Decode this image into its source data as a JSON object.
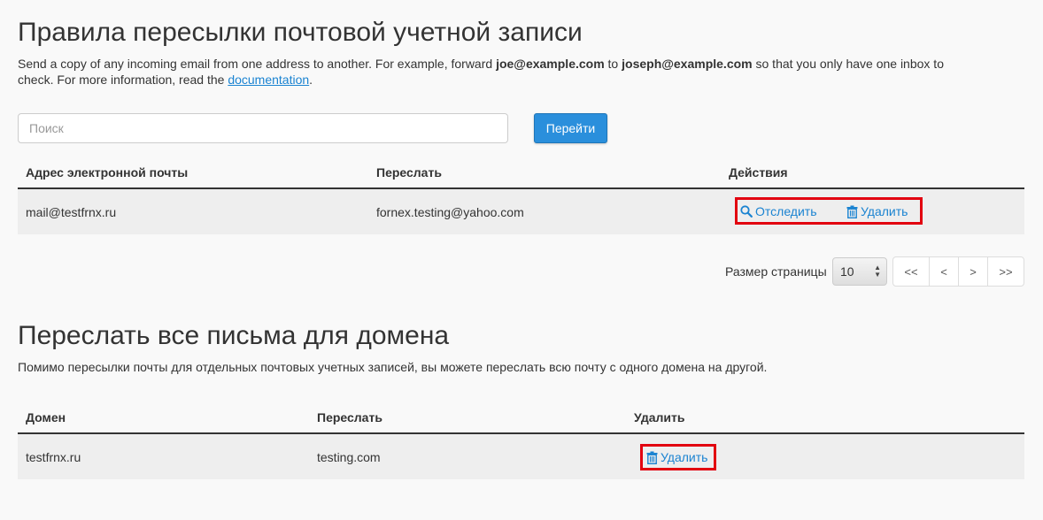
{
  "forwarders": {
    "title": "Правила пересылки почтовой учетной записи",
    "description": {
      "part1": "Send a copy of any incoming email from one address to another. For example, forward ",
      "bold1": "joe@example.com",
      "part2": " to ",
      "bold2": "joseph@example.com",
      "part3": " so that you only have one inbox to",
      "line2_prefix": "check. For more information, read the ",
      "link": "documentation",
      "line2_suffix": "."
    },
    "search": {
      "placeholder": "Поиск",
      "button": "Перейти"
    },
    "columns": [
      "Адрес электронной почты",
      "Переслать",
      "Действия"
    ],
    "rows": [
      {
        "email": "mail@testfrnx.ru",
        "forward": "fornex.testing@yahoo.com",
        "trace": "Отследить",
        "delete": "Удалить"
      }
    ],
    "pagination": {
      "page_size_label": "Размер страницы",
      "page_size": "10",
      "buttons": [
        "<<",
        "<",
        ">",
        ">>"
      ]
    }
  },
  "domain_forwarders": {
    "title": "Переслать все письма для домена",
    "description": "Помимо пересылки почты для отдельных почтовых учетных записей, вы можете переслать всю почту с одного домена на другой.",
    "columns": [
      "Домен",
      "Переслать",
      "Удалить"
    ],
    "rows": [
      {
        "domain": "testfrnx.ru",
        "forward": "testing.com",
        "delete": "Удалить"
      }
    ]
  },
  "colors": {
    "link": "#1a83d1",
    "primary_button": "#2a8fdc",
    "highlight": "#e2000f"
  }
}
